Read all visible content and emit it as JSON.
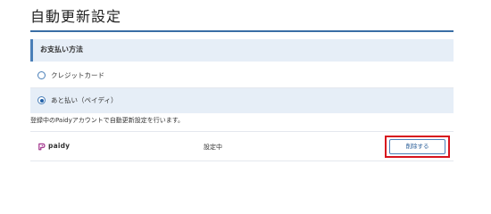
{
  "page": {
    "title": "自動更新設定"
  },
  "payment_section": {
    "header": "お支払い方法",
    "options": [
      {
        "label": "クレジットカード",
        "selected": false
      },
      {
        "label": "あと払い（ペイディ）",
        "selected": true
      }
    ]
  },
  "note": "登録中のPaidyアカウントで自動更新設定を行います。",
  "account_row": {
    "brand_name": "paidy",
    "brand_icon": "paidy-logo-icon",
    "status": "設定中",
    "delete_label": "削除する"
  },
  "colors": {
    "accent": "#3a6ea5",
    "selected_bg": "#e6eef7",
    "highlight": "#d7141e",
    "paidy_brand": "#a4388f"
  }
}
